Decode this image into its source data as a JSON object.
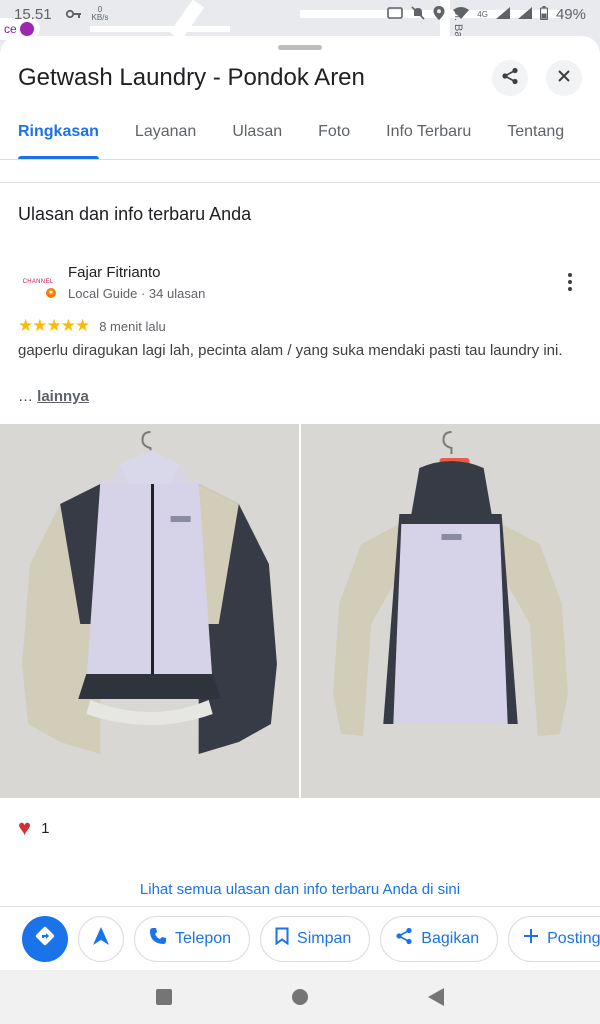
{
  "status_bar": {
    "time": "15.51",
    "speed_value": "0",
    "speed_unit": "KB/s",
    "network_label": "4G",
    "battery": "49%"
  },
  "map": {
    "street_label": "Jl. Bambu",
    "place_chip": "ce"
  },
  "place": {
    "title": "Getwash Laundry - Pondok Aren"
  },
  "tabs": [
    {
      "label": "Ringkasan",
      "active": true
    },
    {
      "label": "Layanan",
      "active": false
    },
    {
      "label": "Ulasan",
      "active": false
    },
    {
      "label": "Foto",
      "active": false
    },
    {
      "label": "Info Terbaru",
      "active": false
    },
    {
      "label": "Tentang",
      "active": false
    }
  ],
  "section": {
    "heading": "Ulasan dan info terbaru Anda"
  },
  "review": {
    "avatar_text": "CHANNEL",
    "reviewer_name": "Fajar Fitrianto",
    "reviewer_meta": "Local Guide · 34 ulasan",
    "stars": "★★★★★",
    "rating": 5,
    "time": "8 menit lalu",
    "text": "gaperlu diragukan lagi lah, pecinta alam / yang suka mendaki pasti tau laundry ini.",
    "ellipsis": "…",
    "more_label": "lainnya",
    "photos": [
      {
        "alt": "Jacket front view"
      },
      {
        "alt": "Jacket back view"
      }
    ],
    "reaction_count": "1"
  },
  "see_all_label": "Lihat semua ulasan dan info terbaru Anda di sini",
  "actions": {
    "call_label": "Telepon",
    "save_label": "Simpan",
    "share_label": "Bagikan",
    "post_label": "Posting"
  },
  "colors": {
    "accent": "#1a73e8",
    "star": "#fbbc04",
    "heart": "#d32f2f"
  }
}
